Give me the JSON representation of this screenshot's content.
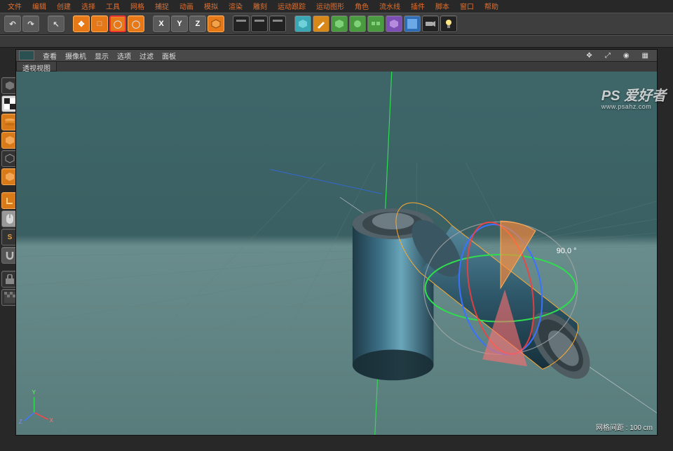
{
  "menubar": {
    "items": [
      "文件",
      "编辑",
      "创建",
      "选择",
      "工具",
      "网格",
      "捕捉",
      "动画",
      "模拟",
      "渲染",
      "雕刻",
      "运动跟踪",
      "运动图形",
      "角色",
      "流水线",
      "插件",
      "脚本",
      "窗口",
      "帮助"
    ]
  },
  "toolbar": {
    "undo": "↶",
    "redo": "↷",
    "select": "↖",
    "move": "✥",
    "scale": "□",
    "rotate": "◯",
    "recent": "◯",
    "x": "X",
    "y": "Y",
    "z": "Z"
  },
  "viewport_menu": {
    "items": [
      "查看",
      "摄像机",
      "显示",
      "选项",
      "过滤",
      "面板"
    ]
  },
  "viewport_tab": "透视视图",
  "hud": {
    "angle": "90.0 °"
  },
  "status": {
    "grid": "网格间距 : 100 cm"
  },
  "watermark": {
    "title": "PS 爱好者",
    "url": "www.psahz.com"
  },
  "axis": {
    "x": "X",
    "y": "Y",
    "z": "Z"
  }
}
